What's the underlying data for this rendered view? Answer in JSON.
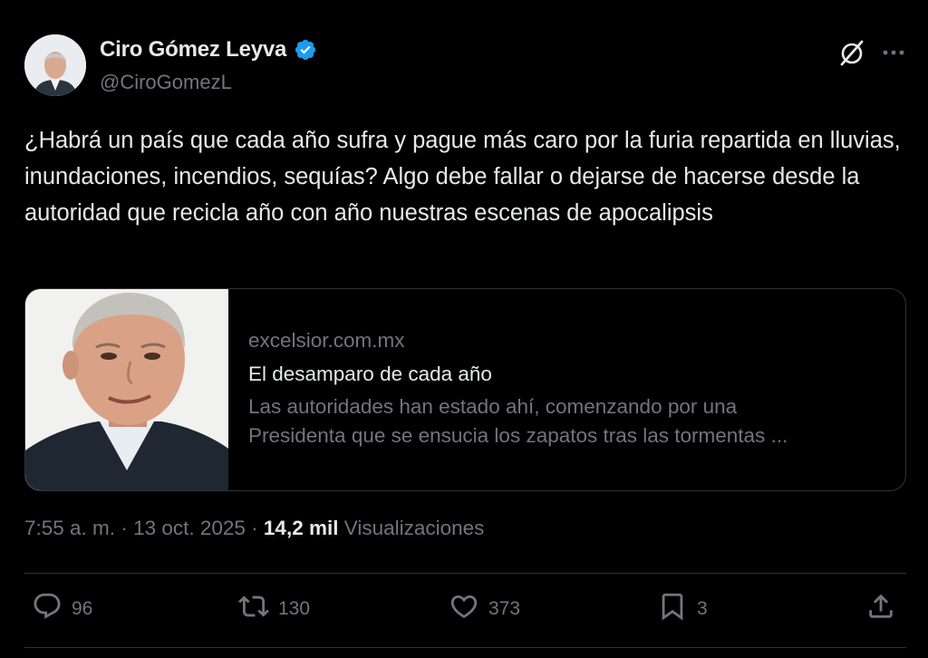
{
  "author": {
    "display_name": "Ciro Gómez Leyva",
    "handle": "@CiroGomezL",
    "verified": true
  },
  "tweet": {
    "text": "¿Habrá un país que cada año sufra y pague más caro por la furia repartida en lluvias, inundaciones, incendios, sequías? Algo debe fallar o dejarse de hacerse desde la autoridad que recicla año con año nuestras escenas de apocalipsis"
  },
  "link_card": {
    "domain": "excelsior.com.mx",
    "title": "El desamparo de cada año",
    "description_line1": "Las autoridades han estado ahí, comenzando por una",
    "description_line2": "Presidenta que se ensucia los zapatos tras las tormentas ..."
  },
  "meta": {
    "time": "7:55 a. m.",
    "separator1": " · ",
    "date": "13 oct. 2025",
    "separator2": " · ",
    "views_count": "14,2 mil",
    "views_label": " Visualizaciones"
  },
  "actions": {
    "replies": "96",
    "reposts": "130",
    "likes": "373",
    "bookmarks": "3"
  },
  "icons": {
    "header_right": [
      "grok-icon",
      "more-icon"
    ],
    "action_bar": [
      "reply-icon",
      "repost-icon",
      "like-icon",
      "bookmark-icon",
      "share-icon"
    ]
  },
  "colors": {
    "background": "#000000",
    "primary_text": "#e7e9ea",
    "secondary_text": "#71767b",
    "border": "#2f3336",
    "verified_badge": "#1d9bf0"
  }
}
